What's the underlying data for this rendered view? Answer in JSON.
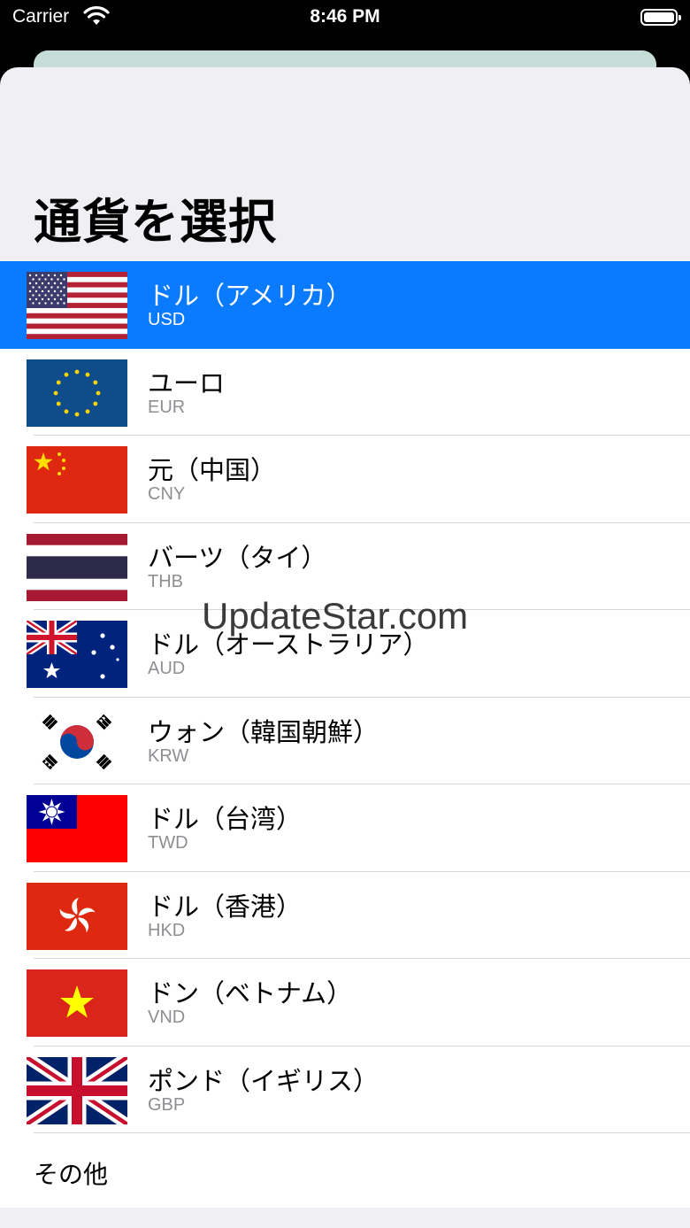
{
  "status_bar": {
    "carrier": "Carrier",
    "time": "8:46 PM"
  },
  "title": "通貨を選択",
  "currencies": [
    {
      "name": "ドル（アメリカ）",
      "code": "USD",
      "flag": "us-flag",
      "selected": true
    },
    {
      "name": "ユーロ",
      "code": "EUR",
      "flag": "eu-flag",
      "selected": false
    },
    {
      "name": "元（中国）",
      "code": "CNY",
      "flag": "cn-flag",
      "selected": false
    },
    {
      "name": "バーツ（タイ）",
      "code": "THB",
      "flag": "th-flag",
      "selected": false
    },
    {
      "name": "ドル（オーストラリア）",
      "code": "AUD",
      "flag": "au-flag",
      "selected": false
    },
    {
      "name": "ウォン（韓国朝鮮）",
      "code": "KRW",
      "flag": "kr-flag",
      "selected": false
    },
    {
      "name": "ドル（台湾）",
      "code": "TWD",
      "flag": "tw-flag",
      "selected": false
    },
    {
      "name": "ドル（香港）",
      "code": "HKD",
      "flag": "hk-flag",
      "selected": false
    },
    {
      "name": "ドン（ベトナム）",
      "code": "VND",
      "flag": "vn-flag",
      "selected": false
    },
    {
      "name": "ポンド（イギリス）",
      "code": "GBP",
      "flag": "gb-flag",
      "selected": false
    }
  ],
  "other_label": "その他",
  "watermark": "UpdateStar.com",
  "colors": {
    "accent": "#0a7aff",
    "background": "#efeff4",
    "secondary_text": "#8e8e93"
  }
}
